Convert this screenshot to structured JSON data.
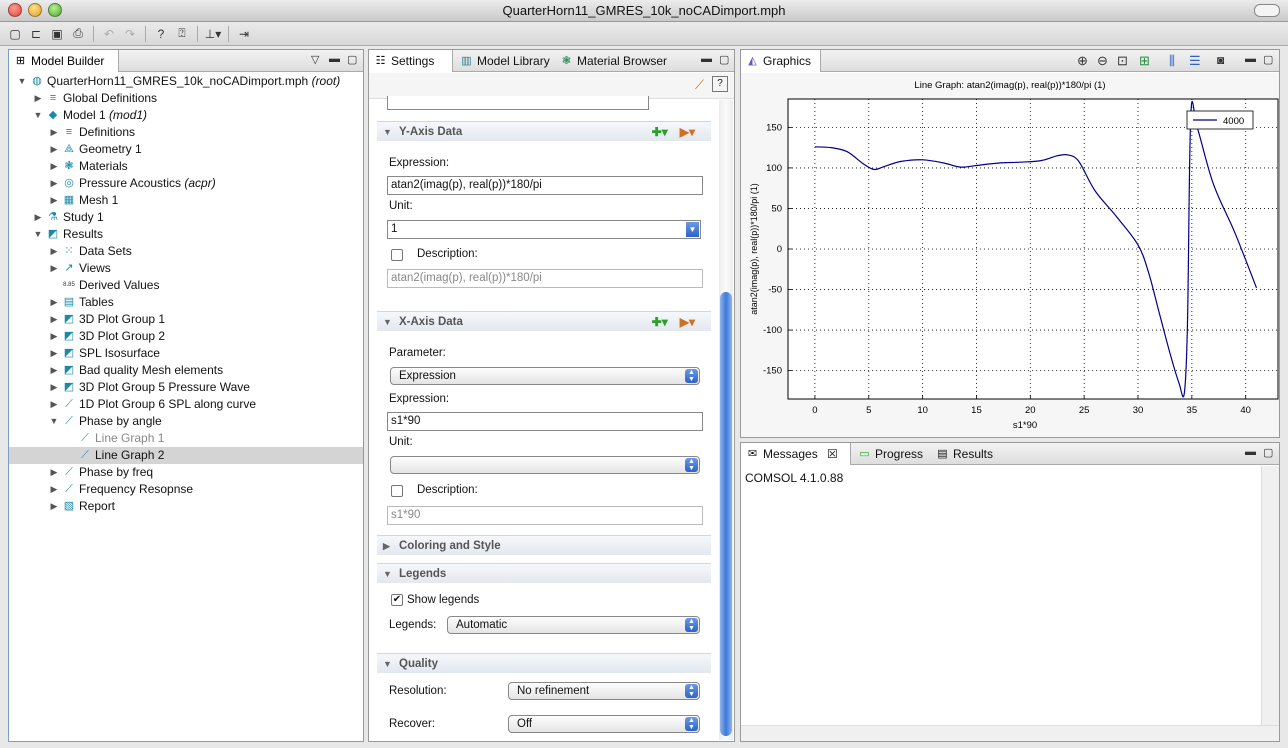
{
  "window": {
    "title": "QuarterHorn11_GMRES_10k_noCADimport.mph"
  },
  "model_builder": {
    "tab_label": "Model Builder",
    "tree": [
      {
        "label": "QuarterHorn11_GMRES_10k_noCADimport.mph",
        "suffix": "(root)",
        "level": 0,
        "arrow": "open",
        "icon": "file-icon",
        "glyph": "◍"
      },
      {
        "label": "Global Definitions",
        "suffix": "",
        "level": 1,
        "arrow": "closed",
        "icon": "global-definitions-icon",
        "glyph": "≡"
      },
      {
        "label": "Model 1",
        "suffix": "(mod1)",
        "level": 1,
        "arrow": "open",
        "icon": "model-icon",
        "glyph": "◆"
      },
      {
        "label": "Definitions",
        "suffix": "",
        "level": 2,
        "arrow": "closed",
        "icon": "definitions-icon",
        "glyph": "≡"
      },
      {
        "label": "Geometry 1",
        "suffix": "",
        "level": 2,
        "arrow": "closed",
        "icon": "geometry-icon",
        "glyph": "⟁"
      },
      {
        "label": "Materials",
        "suffix": "",
        "level": 2,
        "arrow": "closed",
        "icon": "materials-icon",
        "glyph": "❃"
      },
      {
        "label": "Pressure Acoustics",
        "suffix": "(acpr)",
        "level": 2,
        "arrow": "closed",
        "icon": "pressure-acoustics-icon",
        "glyph": "◎"
      },
      {
        "label": "Mesh 1",
        "suffix": "",
        "level": 2,
        "arrow": "closed",
        "icon": "mesh-icon",
        "glyph": "▦"
      },
      {
        "label": "Study 1",
        "suffix": "",
        "level": 1,
        "arrow": "closed",
        "icon": "study-icon",
        "glyph": "⚗"
      },
      {
        "label": "Results",
        "suffix": "",
        "level": 1,
        "arrow": "open",
        "icon": "results-icon",
        "glyph": "◩"
      },
      {
        "label": "Data Sets",
        "suffix": "",
        "level": 2,
        "arrow": "closed",
        "icon": "data-sets-icon",
        "glyph": "⁙"
      },
      {
        "label": "Views",
        "suffix": "",
        "level": 2,
        "arrow": "closed",
        "icon": "views-icon",
        "glyph": "↗"
      },
      {
        "label": "Derived Values",
        "suffix": "",
        "level": 2,
        "arrow": "none",
        "icon": "derived-values-icon",
        "glyph": "8.85"
      },
      {
        "label": "Tables",
        "suffix": "",
        "level": 2,
        "arrow": "closed",
        "icon": "tables-icon",
        "glyph": "▤"
      },
      {
        "label": "3D Plot Group 1",
        "suffix": "",
        "level": 2,
        "arrow": "closed",
        "icon": "plot-group-3d-icon",
        "glyph": "◩"
      },
      {
        "label": "3D Plot Group 2",
        "suffix": "",
        "level": 2,
        "arrow": "closed",
        "icon": "plot-group-3d-icon",
        "glyph": "◩"
      },
      {
        "label": "SPL Isosurface",
        "suffix": "",
        "level": 2,
        "arrow": "closed",
        "icon": "plot-group-3d-icon",
        "glyph": "◩"
      },
      {
        "label": "Bad quality Mesh elements",
        "suffix": "",
        "level": 2,
        "arrow": "closed",
        "icon": "plot-group-3d-icon",
        "glyph": "◩"
      },
      {
        "label": "3D Plot Group 5 Pressure Wave",
        "suffix": "",
        "level": 2,
        "arrow": "closed",
        "icon": "plot-group-3d-icon",
        "glyph": "◩"
      },
      {
        "label": "1D Plot Group 6 SPL along curve",
        "suffix": "",
        "level": 2,
        "arrow": "closed",
        "icon": "plot-group-1d-icon",
        "glyph": "⟋"
      },
      {
        "label": "Phase by angle",
        "suffix": "",
        "level": 2,
        "arrow": "open",
        "icon": "plot-group-1d-icon",
        "glyph": "⟋"
      },
      {
        "label": "Line Graph 1",
        "suffix": "",
        "level": 3,
        "arrow": "none",
        "icon": "line-graph-icon",
        "glyph": "⟋",
        "dim": true
      },
      {
        "label": "Line Graph 2",
        "suffix": "",
        "level": 3,
        "arrow": "none",
        "icon": "line-graph-icon",
        "glyph": "⟋",
        "selected": true
      },
      {
        "label": "Phase by freq",
        "suffix": "",
        "level": 2,
        "arrow": "closed",
        "icon": "plot-group-1d-icon",
        "glyph": "⟋"
      },
      {
        "label": "Frequency Resopnse",
        "suffix": "",
        "level": 2,
        "arrow": "closed",
        "icon": "plot-group-1d-icon",
        "glyph": "⟋"
      },
      {
        "label": "Report",
        "suffix": "",
        "level": 2,
        "arrow": "closed",
        "icon": "report-icon",
        "glyph": "▧"
      }
    ]
  },
  "settings": {
    "tabs": {
      "settings": "Settings",
      "model_library": "Model Library",
      "material_browser": "Material Browser"
    },
    "y_axis": {
      "header": "Y-Axis Data",
      "expression_label": "Expression:",
      "expression": "atan2(imag(p), real(p))*180/pi",
      "unit_label": "Unit:",
      "unit": "1",
      "description_label": "Description:",
      "description": "atan2(imag(p), real(p))*180/pi"
    },
    "x_axis": {
      "header": "X-Axis Data",
      "parameter_label": "Parameter:",
      "parameter": "Expression",
      "expression_label": "Expression:",
      "expression": "s1*90",
      "unit_label": "Unit:",
      "unit": "",
      "description_label": "Description:",
      "description": "s1*90"
    },
    "coloring": {
      "header": "Coloring and Style"
    },
    "legends": {
      "header": "Legends",
      "show_label": "Show legends",
      "show": true,
      "legends_label": "Legends:",
      "legends_value": "Automatic"
    },
    "quality": {
      "header": "Quality",
      "resolution_label": "Resolution:",
      "resolution": "No refinement",
      "recover_label": "Recover:",
      "recover": "Off"
    }
  },
  "graphics": {
    "tab_label": "Graphics"
  },
  "messages": {
    "tabs": {
      "messages": "Messages",
      "progress": "Progress",
      "results": "Results"
    },
    "text": "COMSOL 4.1.0.88"
  },
  "colors": {
    "series": "#00008b",
    "selection_blue": "#3d78d8"
  },
  "chart_data": {
    "type": "line",
    "title": "Line Graph: atan2(imag(p), real(p))*180/pi (1)",
    "xlabel": "s1*90",
    "ylabel": "atan2(imag(p), real(p))*180/pi (1)",
    "xlim": [
      -2.5,
      43
    ],
    "ylim": [
      -185,
      185
    ],
    "xticks": [
      "0",
      "5",
      "10",
      "15",
      "20",
      "25",
      "30",
      "35",
      "40"
    ],
    "yticks": [
      "150",
      "100",
      "50",
      "0",
      "-50",
      "-100",
      "-150"
    ],
    "grid": true,
    "legend_position": "top-right",
    "series": [
      {
        "name": "4000",
        "x": [
          0,
          1.5,
          3,
          4.5,
          5.5,
          6.5,
          8,
          10,
          12,
          13.5,
          15,
          17,
          19,
          21,
          22.5,
          23.5,
          24.5,
          26,
          28,
          30,
          31,
          32,
          33,
          33.8,
          34.3,
          34.6,
          34.9,
          35.5,
          37,
          39,
          41
        ],
        "y": [
          126,
          125,
          120,
          105,
          98,
          102,
          108,
          110,
          106,
          101,
          103,
          106,
          107,
          109,
          115,
          116,
          108,
          72,
          40,
          5,
          -30,
          -80,
          -130,
          -165,
          -178,
          -90,
          165,
          150,
          80,
          20,
          -48
        ]
      }
    ]
  }
}
